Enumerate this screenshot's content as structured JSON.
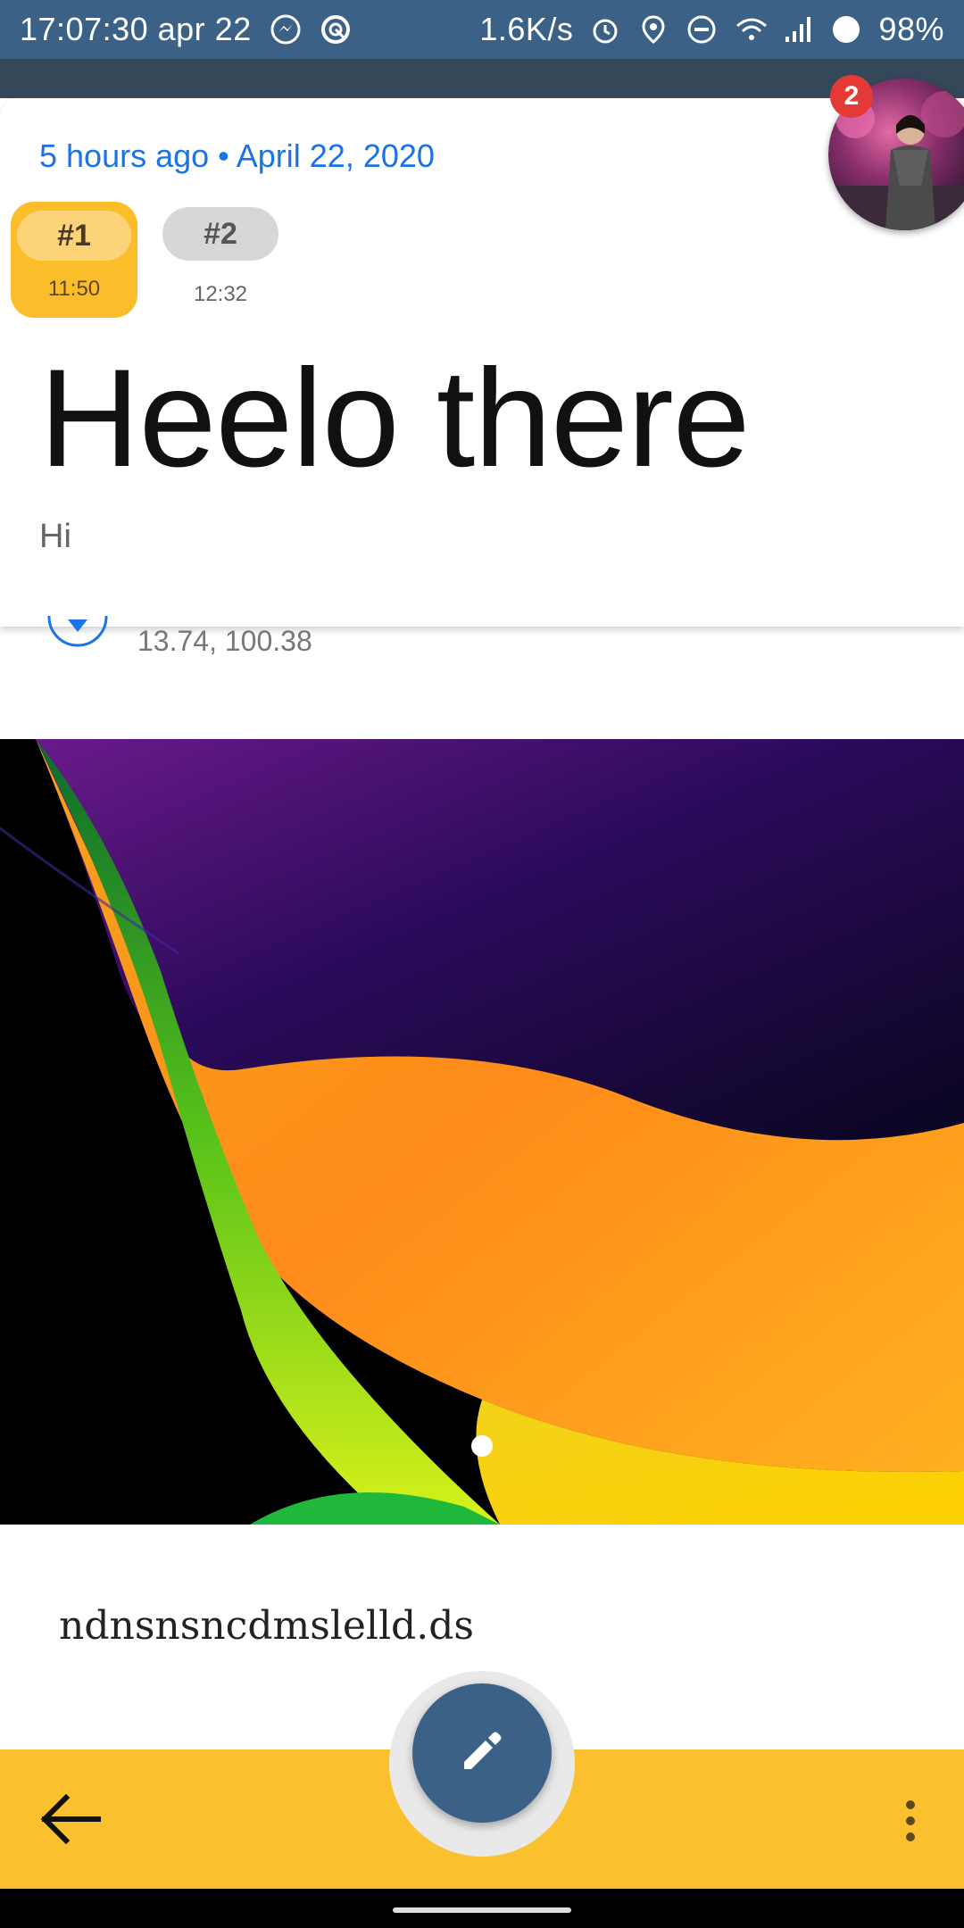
{
  "status_bar": {
    "time": "17:07:30 apr 22",
    "speed": "1.6K/s",
    "battery": "98%"
  },
  "note": {
    "date_line": "5 hours ago • April 22, 2020",
    "versions": [
      {
        "label": "#1",
        "time": "11:50",
        "selected": true
      },
      {
        "label": "#2",
        "time": "12:32",
        "selected": false
      }
    ],
    "title": "Heelo there",
    "subtitle": "Hi",
    "coordinates": "13.74, 100.38",
    "body": "ndnsnsncdmslelld.ds",
    "image_page_index": 1
  },
  "avatar": {
    "badge_count": "2"
  },
  "icons": {
    "back": "arrow-back-icon",
    "edit": "pencil-icon",
    "more": "more-vert-icon",
    "location": "location-pin-icon"
  },
  "colors": {
    "status_bar": "#3b6186",
    "accent_yellow": "#fbc02d",
    "link_blue": "#1a73e8",
    "badge_red": "#e53935"
  }
}
